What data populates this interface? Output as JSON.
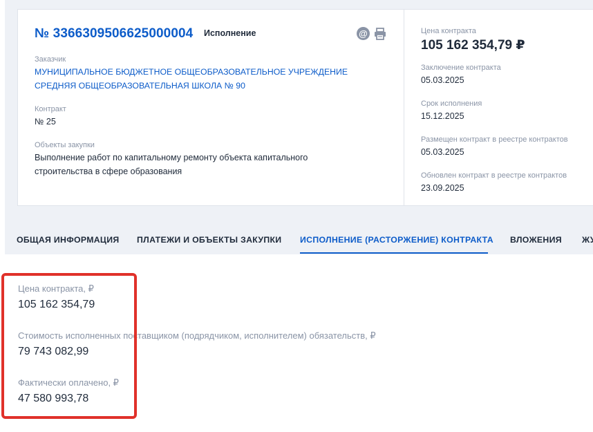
{
  "card": {
    "reg_number": "№ 3366309506625000004",
    "status": "Исполнение",
    "customer_label": "Заказчик",
    "customer_line1": "МУНИЦИПАЛЬНОЕ БЮДЖЕТНОЕ ОБЩЕОБРАЗОВАТЕЛЬНОЕ УЧРЕЖДЕНИЕ",
    "customer_line2": "СРЕДНЯЯ ОБЩЕОБРАЗОВАТЕЛЬНАЯ ШКОЛА № 90",
    "contract_label": "Контракт",
    "contract_value": "№ 25",
    "objects_label": "Объекты закупки",
    "objects_line1": "Выполнение работ по капитальному ремонту объекта капитального",
    "objects_line2": "строительства в сфере образования"
  },
  "summary": {
    "price_label": "Цена контракта",
    "price_value": "105 162 354,79 ₽",
    "conclusion_label": "Заключение контракта",
    "conclusion_value": "05.03.2025",
    "term_label": "Срок исполнения",
    "term_value": "15.12.2025",
    "placed_label": "Размещен контракт в реестре контрактов",
    "placed_value": "05.03.2025",
    "updated_label": "Обновлен контракт в реестре контрактов",
    "updated_value": "23.09.2025"
  },
  "tabs": [
    {
      "label": "ОБЩАЯ ИНФОРМАЦИЯ"
    },
    {
      "label": "ПЛАТЕЖИ И ОБЪЕКТЫ ЗАКУПКИ"
    },
    {
      "label": "ИСПОЛНЕНИЕ (РАСТОРЖЕНИЕ) КОНТРАКТА"
    },
    {
      "label": "ВЛОЖЕНИЯ"
    },
    {
      "label": "ЖУ"
    }
  ],
  "execution": {
    "price_label": "Цена контракта, ₽",
    "price_value": "105 162 354,79",
    "executed_label": "Стоимость исполненных поставщиком (подрядчиком, исполнителем) обязательств, ₽",
    "executed_value": "79 743 082,99",
    "paid_label": "Фактически оплачено, ₽",
    "paid_value": "47 580 993,78"
  },
  "icons": {
    "email": "at-icon",
    "print": "printer-icon"
  },
  "colors": {
    "accent": "#0d5cc9",
    "highlight": "#e0312a"
  }
}
